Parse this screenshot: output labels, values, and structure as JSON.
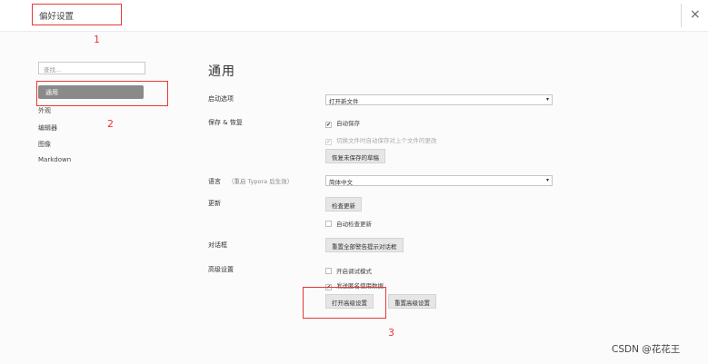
{
  "window": {
    "title": "偏好设置",
    "close_glyph": "×"
  },
  "sidebar": {
    "search_placeholder": "查找...",
    "items": [
      {
        "label": "通用",
        "active": true
      },
      {
        "label": "外观",
        "active": false
      },
      {
        "label": "编辑器",
        "active": false
      },
      {
        "label": "图像",
        "active": false
      },
      {
        "label": "Markdown",
        "active": false
      }
    ]
  },
  "main": {
    "heading": "通用",
    "startup": {
      "label": "启动选项",
      "selected": "打开新文件",
      "caret": "▾"
    },
    "save": {
      "label": "保存 & 恢复",
      "auto_save": {
        "label": "自动保存",
        "checked": true
      },
      "save_on_switch": {
        "label": "切换文件时自动保存对上个文件的更改",
        "checked": true,
        "disabled": true
      },
      "recover_button": "恢复未保存的草稿"
    },
    "language": {
      "label": "语言",
      "hint": "（重启 Typora 后生效）",
      "selected": "简体中文",
      "caret": "▾"
    },
    "update": {
      "label": "更新",
      "check_button": "检查更新",
      "auto_check": {
        "label": "自动检查更新",
        "checked": false
      }
    },
    "dialog": {
      "label": "对话框",
      "reset_button": "重置全部警告提示对话框"
    },
    "advanced": {
      "label": "高级设置",
      "debug_mode": {
        "label": "开启调试模式",
        "checked": false
      },
      "send_usage": {
        "label": "发送匿名使用数据",
        "checked": true
      },
      "open_button": "打开高级设置",
      "reset_button": "重置高级设置"
    }
  },
  "annotations": {
    "color": "#e53935",
    "labels": [
      "1",
      "2",
      "3"
    ]
  },
  "watermark": "CSDN @花花王"
}
